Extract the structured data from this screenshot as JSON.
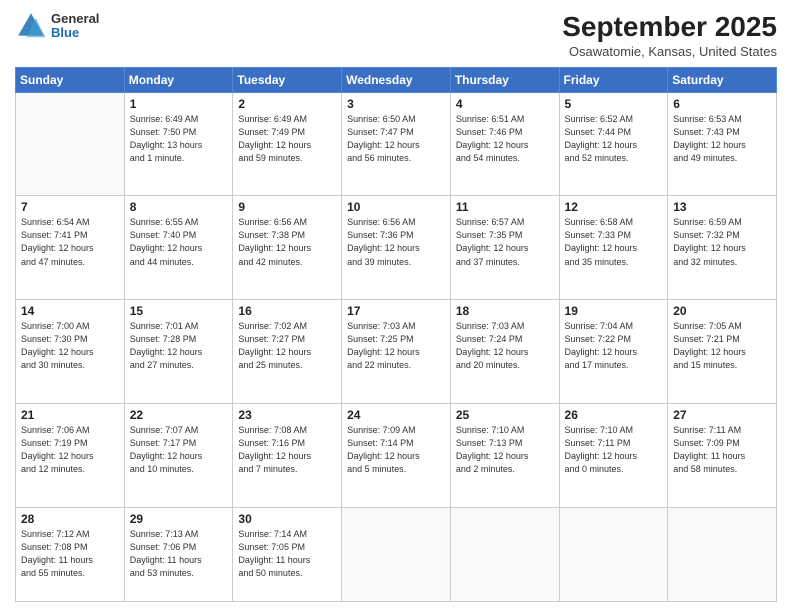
{
  "logo": {
    "general": "General",
    "blue": "Blue"
  },
  "header": {
    "month": "September 2025",
    "location": "Osawatomie, Kansas, United States"
  },
  "days_of_week": [
    "Sunday",
    "Monday",
    "Tuesday",
    "Wednesday",
    "Thursday",
    "Friday",
    "Saturday"
  ],
  "weeks": [
    [
      {
        "num": "",
        "info": ""
      },
      {
        "num": "1",
        "info": "Sunrise: 6:49 AM\nSunset: 7:50 PM\nDaylight: 13 hours\nand 1 minute."
      },
      {
        "num": "2",
        "info": "Sunrise: 6:49 AM\nSunset: 7:49 PM\nDaylight: 12 hours\nand 59 minutes."
      },
      {
        "num": "3",
        "info": "Sunrise: 6:50 AM\nSunset: 7:47 PM\nDaylight: 12 hours\nand 56 minutes."
      },
      {
        "num": "4",
        "info": "Sunrise: 6:51 AM\nSunset: 7:46 PM\nDaylight: 12 hours\nand 54 minutes."
      },
      {
        "num": "5",
        "info": "Sunrise: 6:52 AM\nSunset: 7:44 PM\nDaylight: 12 hours\nand 52 minutes."
      },
      {
        "num": "6",
        "info": "Sunrise: 6:53 AM\nSunset: 7:43 PM\nDaylight: 12 hours\nand 49 minutes."
      }
    ],
    [
      {
        "num": "7",
        "info": "Sunrise: 6:54 AM\nSunset: 7:41 PM\nDaylight: 12 hours\nand 47 minutes."
      },
      {
        "num": "8",
        "info": "Sunrise: 6:55 AM\nSunset: 7:40 PM\nDaylight: 12 hours\nand 44 minutes."
      },
      {
        "num": "9",
        "info": "Sunrise: 6:56 AM\nSunset: 7:38 PM\nDaylight: 12 hours\nand 42 minutes."
      },
      {
        "num": "10",
        "info": "Sunrise: 6:56 AM\nSunset: 7:36 PM\nDaylight: 12 hours\nand 39 minutes."
      },
      {
        "num": "11",
        "info": "Sunrise: 6:57 AM\nSunset: 7:35 PM\nDaylight: 12 hours\nand 37 minutes."
      },
      {
        "num": "12",
        "info": "Sunrise: 6:58 AM\nSunset: 7:33 PM\nDaylight: 12 hours\nand 35 minutes."
      },
      {
        "num": "13",
        "info": "Sunrise: 6:59 AM\nSunset: 7:32 PM\nDaylight: 12 hours\nand 32 minutes."
      }
    ],
    [
      {
        "num": "14",
        "info": "Sunrise: 7:00 AM\nSunset: 7:30 PM\nDaylight: 12 hours\nand 30 minutes."
      },
      {
        "num": "15",
        "info": "Sunrise: 7:01 AM\nSunset: 7:28 PM\nDaylight: 12 hours\nand 27 minutes."
      },
      {
        "num": "16",
        "info": "Sunrise: 7:02 AM\nSunset: 7:27 PM\nDaylight: 12 hours\nand 25 minutes."
      },
      {
        "num": "17",
        "info": "Sunrise: 7:03 AM\nSunset: 7:25 PM\nDaylight: 12 hours\nand 22 minutes."
      },
      {
        "num": "18",
        "info": "Sunrise: 7:03 AM\nSunset: 7:24 PM\nDaylight: 12 hours\nand 20 minutes."
      },
      {
        "num": "19",
        "info": "Sunrise: 7:04 AM\nSunset: 7:22 PM\nDaylight: 12 hours\nand 17 minutes."
      },
      {
        "num": "20",
        "info": "Sunrise: 7:05 AM\nSunset: 7:21 PM\nDaylight: 12 hours\nand 15 minutes."
      }
    ],
    [
      {
        "num": "21",
        "info": "Sunrise: 7:06 AM\nSunset: 7:19 PM\nDaylight: 12 hours\nand 12 minutes."
      },
      {
        "num": "22",
        "info": "Sunrise: 7:07 AM\nSunset: 7:17 PM\nDaylight: 12 hours\nand 10 minutes."
      },
      {
        "num": "23",
        "info": "Sunrise: 7:08 AM\nSunset: 7:16 PM\nDaylight: 12 hours\nand 7 minutes."
      },
      {
        "num": "24",
        "info": "Sunrise: 7:09 AM\nSunset: 7:14 PM\nDaylight: 12 hours\nand 5 minutes."
      },
      {
        "num": "25",
        "info": "Sunrise: 7:10 AM\nSunset: 7:13 PM\nDaylight: 12 hours\nand 2 minutes."
      },
      {
        "num": "26",
        "info": "Sunrise: 7:10 AM\nSunset: 7:11 PM\nDaylight: 12 hours\nand 0 minutes."
      },
      {
        "num": "27",
        "info": "Sunrise: 7:11 AM\nSunset: 7:09 PM\nDaylight: 11 hours\nand 58 minutes."
      }
    ],
    [
      {
        "num": "28",
        "info": "Sunrise: 7:12 AM\nSunset: 7:08 PM\nDaylight: 11 hours\nand 55 minutes."
      },
      {
        "num": "29",
        "info": "Sunrise: 7:13 AM\nSunset: 7:06 PM\nDaylight: 11 hours\nand 53 minutes."
      },
      {
        "num": "30",
        "info": "Sunrise: 7:14 AM\nSunset: 7:05 PM\nDaylight: 11 hours\nand 50 minutes."
      },
      {
        "num": "",
        "info": ""
      },
      {
        "num": "",
        "info": ""
      },
      {
        "num": "",
        "info": ""
      },
      {
        "num": "",
        "info": ""
      }
    ]
  ]
}
